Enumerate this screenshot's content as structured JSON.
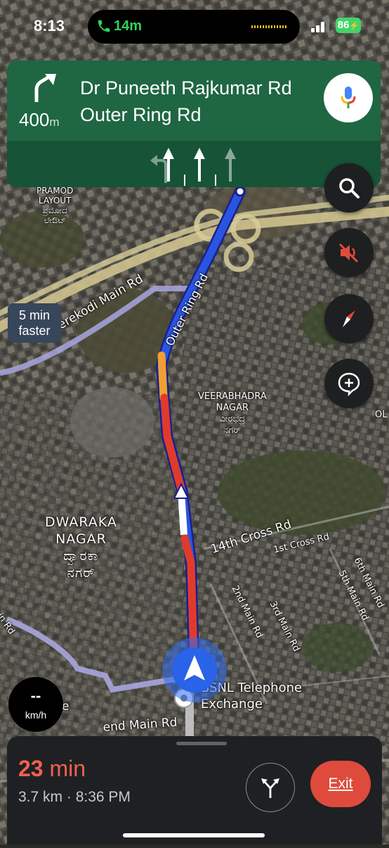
{
  "status_bar": {
    "time": "8:13",
    "call_duration": "14m",
    "battery": "86"
  },
  "navigation": {
    "distance_value": "400",
    "distance_unit": "m",
    "street_primary": "Dr Puneeth Rajkumar Rd",
    "street_secondary": "Outer Ring Rd",
    "maneuver_icon": "turn-slight-right-icon",
    "lanes": [
      "turn-left-lane",
      "straight-lane",
      "straight-lane",
      "straight-lane"
    ]
  },
  "map_labels": {
    "pramod": "PRAMOD\nLAYOUT\nಪ್ರಮೋದ\nಲೇಔಟ್",
    "kerekodi": "Kerekodi Main Rd",
    "outer_ring": "Outer Ring Rd",
    "veerabhadra": "VEERABHADRA\nNAGAR\nವೀರಭದ್ರ\nನಗರ್",
    "dwaraka": "DWARAKA\nNAGAR\nದ್ವಾರಕಾ\nನಗರ್",
    "cross14": "14th Cross Rd",
    "cross1": "1st Cross Rd",
    "main2": "2nd Main Rd",
    "main3": "3rd Main Rd",
    "main5": "5th Main Rd",
    "main6": "6th Main Rd",
    "main_left": "ain Rd",
    "bsnl": "BSNL Telephone\nExchange",
    "end_main": "end Main Rd",
    "ol": "OL",
    "e": "e"
  },
  "alternate_route": {
    "text": "5 min\nfaster"
  },
  "speed": {
    "value": "--",
    "unit": "km/h"
  },
  "trip": {
    "eta_value": "23",
    "eta_unit": "min",
    "distance": "3.7 km",
    "arrival": "8:36 PM",
    "separator": " · ",
    "exit_label": "Exit"
  },
  "colors": {
    "banner": "#1f6642",
    "lane_bar": "#165337",
    "route_blue": "#2a55e0",
    "traffic_red": "#e03b2a",
    "traffic_orange": "#f0a030",
    "exit": "#de4b3c",
    "eta": "#ef6150",
    "mute_red": "#e04b3c",
    "compass_red": "#e8453c"
  },
  "icons": {
    "search": "search-icon",
    "mute": "volume-off-icon",
    "compass": "compass-icon",
    "report": "add-report-icon",
    "mic": "mic-icon",
    "routes": "alternate-routes-icon"
  }
}
